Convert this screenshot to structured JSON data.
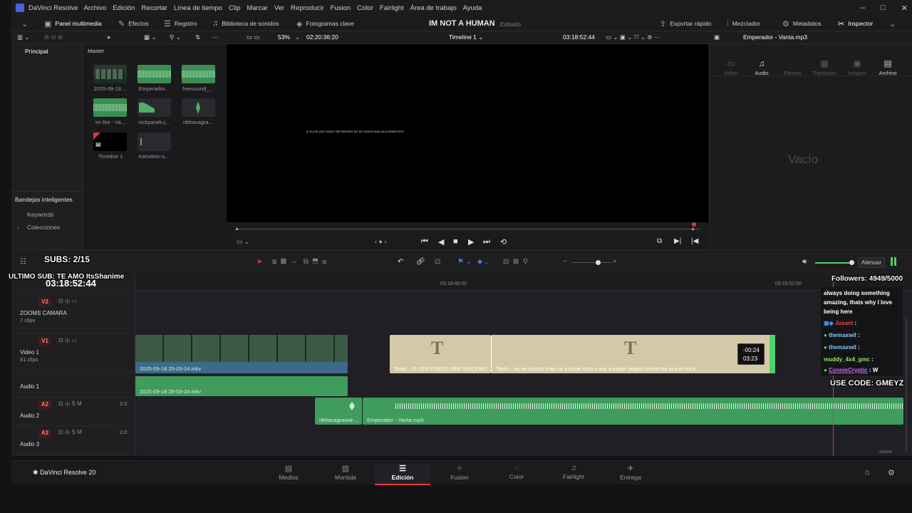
{
  "titlebar": {
    "app_name": "DaVinci Resolve",
    "menus": [
      "Archivo",
      "Edición",
      "Recortar",
      "Línea de tiempo",
      "Clip",
      "Marcar",
      "Ver",
      "Reproducir",
      "Fusion",
      "Color",
      "Fairlight",
      "Área de trabajo",
      "Ayuda"
    ],
    "win_minimize": "–",
    "win_maximize": "□",
    "win_close": "✕"
  },
  "toolbar": {
    "media_pool": "Panel multimedia",
    "effects": "Efectos",
    "index": "Registro",
    "sound_library": "Biblioteca de sonidos",
    "keyframes": "Fotogramas clave",
    "project_title": "IM NOT A HUMAN",
    "project_status": "Editado",
    "quick_export": "Exportar rápido",
    "mixer": "Mezclador",
    "metadata": "Metadatos",
    "inspector": "Inspector"
  },
  "viewer": {
    "zoom": "53%",
    "source_timecode": "02:20:36:20",
    "timeline_name": "Timeline 1",
    "record_timecode": "03:18:52:44",
    "subtitle_text": "SI ELLOS QUE PUEDO SER SINCERO NO SE CUANTO MAS VA A DURAR ESTO"
  },
  "inspector": {
    "clip_name": "Emperador - Vanta.mp3",
    "tabs": [
      "Video",
      "Audio",
      "Efectos",
      "Transición",
      "Imagen",
      "Archivo"
    ],
    "empty_label": "Vacío"
  },
  "leftnav": {
    "main": "Principal",
    "smart_bins": "Bandejas inteligentes",
    "keywords": "Keywords",
    "collections": "Colecciones"
  },
  "mediapool": {
    "bin": "Master",
    "items": [
      "2025-09-18 ...",
      "Emperador...",
      "freesound_...",
      "im fire - Va...",
      "nickpanek-j...",
      "ribhavagra...",
      "Timeline 1",
      "transition-s..."
    ]
  },
  "timeline": {
    "timecode": "03:18:52:44",
    "ruler_marks": [
      "03:18:48:00",
      "03:18:52:00"
    ],
    "tracks": [
      {
        "id": "V2",
        "name": "ZOOMS CAMARA",
        "clips": "7 clips"
      },
      {
        "id": "V1",
        "name": "Video 1",
        "clips": "81 clips"
      },
      {
        "id": "A1",
        "name": "Audio 1",
        "clips": ""
      },
      {
        "id": "A2",
        "name": "Audio 2",
        "clips": "",
        "level": "2.0"
      },
      {
        "id": "A3",
        "name": "Audio 3",
        "clips": "",
        "level": "2.0"
      }
    ],
    "clip_video": "2025-09-18 20-03-24.mkv",
    "clip_text1": "Texto - SI LES PUEDO SER SINCERO",
    "clip_text2": "Texto - no se cuanto mas va a durar esto o voy a poder seguir creciendo aca en kick",
    "clip_audio1": "2025-09-18 20-03-24.mkv",
    "clip_audio2a": "ribhavagrawal-...",
    "clip_audio2b": "Emperador - Vanta.mp3",
    "trim_tooltip_delta": "-00:24",
    "trim_tooltip_dur": "03:23",
    "attenuate": "Atenuar"
  },
  "pages": {
    "brand": "DaVinci Resolve 20",
    "tabs": [
      "Medios",
      "Montaje",
      "Edición",
      "Fusion",
      "Color",
      "Fairlight",
      "Entrega"
    ],
    "active": "Edición"
  },
  "overlays": {
    "subs": "SUBS: 2/15",
    "last_sub": "ULTIMO SUB: TE AMO ItsShanime",
    "followers": "Followers: 4949/5000",
    "code": "USE CODE: GMEYZ",
    "chat_message": "always doing something amazing, thats why I love being here",
    "chat_lines": [
      {
        "user": "Jusani",
        "text": ":"
      },
      {
        "user": "themaxwil",
        "text": ":"
      },
      {
        "user": "themaxwil",
        "text": ":"
      },
      {
        "user": "muddy_4x4_gmc",
        "text": ":"
      },
      {
        "user": "ConnieCryptic",
        "text": ": W"
      }
    ]
  },
  "colors": {
    "accent_red": "#e0383e",
    "video_clip": "#2f5e4f",
    "text_clip": "#d4c9a6",
    "audio_clip": "#3f9c5c",
    "chat_green": "#4fd16b"
  }
}
